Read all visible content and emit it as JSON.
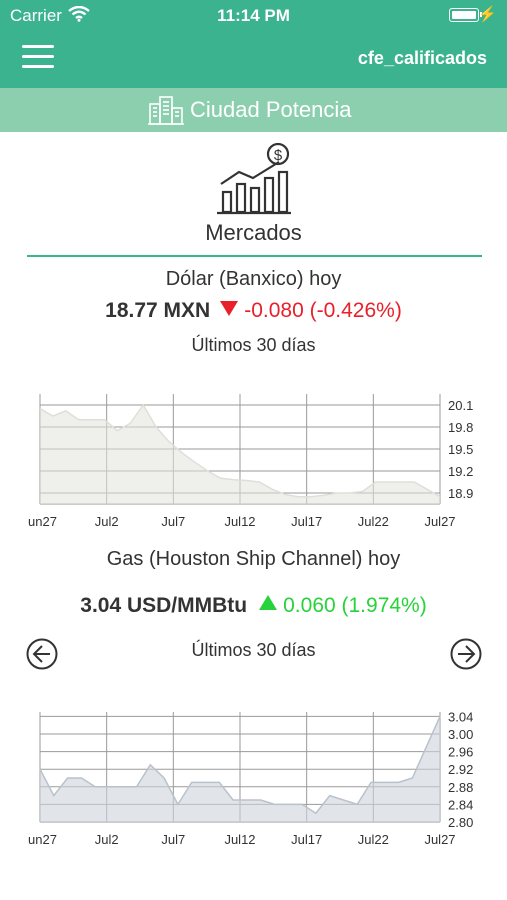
{
  "status": {
    "carrier": "Carrier",
    "time": "11:14 PM"
  },
  "navbar": {
    "user": "cfe_calificados"
  },
  "subbar": {
    "title": "Ciudad Potencia"
  },
  "section": {
    "title": "Mercados"
  },
  "dolar": {
    "heading": "Dólar (Banxico) hoy",
    "price": "18.77 MXN",
    "change": "-0.080 (-0.426%)",
    "subtitle": "Últimos 30 días"
  },
  "gas": {
    "heading": "Gas (Houston Ship Channel) hoy",
    "price": "3.04 USD/MMBtu",
    "change": "0.060 (1.974%)",
    "subtitle": "Últimos 30 días"
  },
  "colors": {
    "accent": "#3bb38f",
    "accent_light": "#8ccfae",
    "down": "#e8202a",
    "up": "#27d33a"
  },
  "chart_data": [
    {
      "type": "area",
      "x_tick_labels": [
        "un27",
        "Jul2",
        "Jul7",
        "Jul12",
        "Jul17",
        "Jul22",
        "Jul27"
      ],
      "y_tick_labels": [
        "20.1",
        "19.8",
        "19.5",
        "19.2",
        "18.9"
      ],
      "ylim": [
        18.75,
        20.25
      ],
      "grid": true,
      "values": [
        20.05,
        19.95,
        20.02,
        19.9,
        19.9,
        19.9,
        19.75,
        19.85,
        20.1,
        19.8,
        19.6,
        19.45,
        19.32,
        19.2,
        19.1,
        19.08,
        19.07,
        19.05,
        18.95,
        18.88,
        18.85,
        18.85,
        18.87,
        18.9,
        18.9,
        18.92,
        19.05,
        19.05,
        19.05,
        19.05,
        18.95,
        18.85
      ]
    },
    {
      "type": "area",
      "x_tick_labels": [
        "un27",
        "Jul2",
        "Jul7",
        "Jul12",
        "Jul17",
        "Jul22",
        "Jul27"
      ],
      "y_tick_labels": [
        "3.04",
        "3.00",
        "2.96",
        "2.92",
        "2.88",
        "2.84",
        "2.80"
      ],
      "ylim": [
        2.8,
        3.05
      ],
      "grid": true,
      "values": [
        2.92,
        2.86,
        2.9,
        2.9,
        2.88,
        2.88,
        2.88,
        2.88,
        2.93,
        2.9,
        2.84,
        2.89,
        2.89,
        2.89,
        2.85,
        2.85,
        2.85,
        2.84,
        2.84,
        2.84,
        2.82,
        2.86,
        2.85,
        2.84,
        2.89,
        2.89,
        2.89,
        2.9,
        2.97,
        3.04
      ]
    }
  ]
}
